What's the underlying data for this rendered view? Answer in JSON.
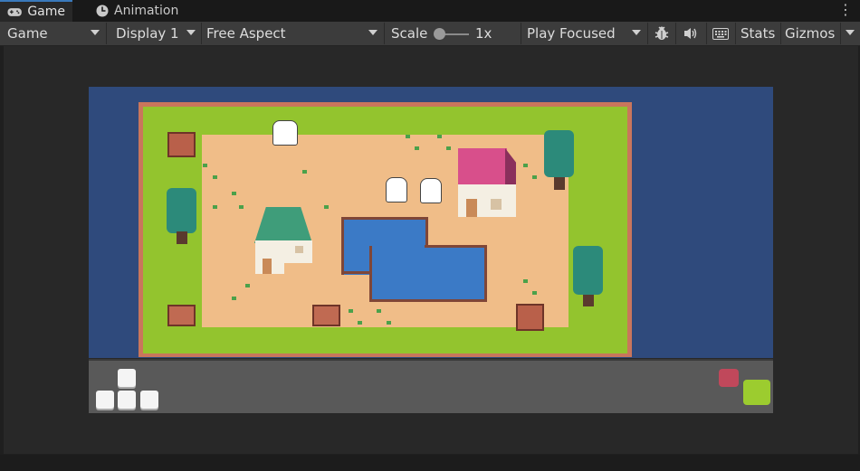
{
  "tabs": [
    {
      "label": "Game",
      "icon": "gamepad-icon"
    },
    {
      "label": "Animation",
      "icon": "animation-icon"
    }
  ],
  "toolbar": {
    "display_mode": "Game",
    "display": "Display 1",
    "aspect": "Free Aspect",
    "scale_label": "Scale",
    "scale_value": "1x",
    "play_mode": "Play Focused",
    "stats": "Stats",
    "gizmos": "Gizmos"
  },
  "colors": {
    "accent": "#3a79bb",
    "grass": "#93c42e",
    "dirt": "#f0bd88",
    "water": "#3b7ac6",
    "background": "#2f4a7c"
  }
}
